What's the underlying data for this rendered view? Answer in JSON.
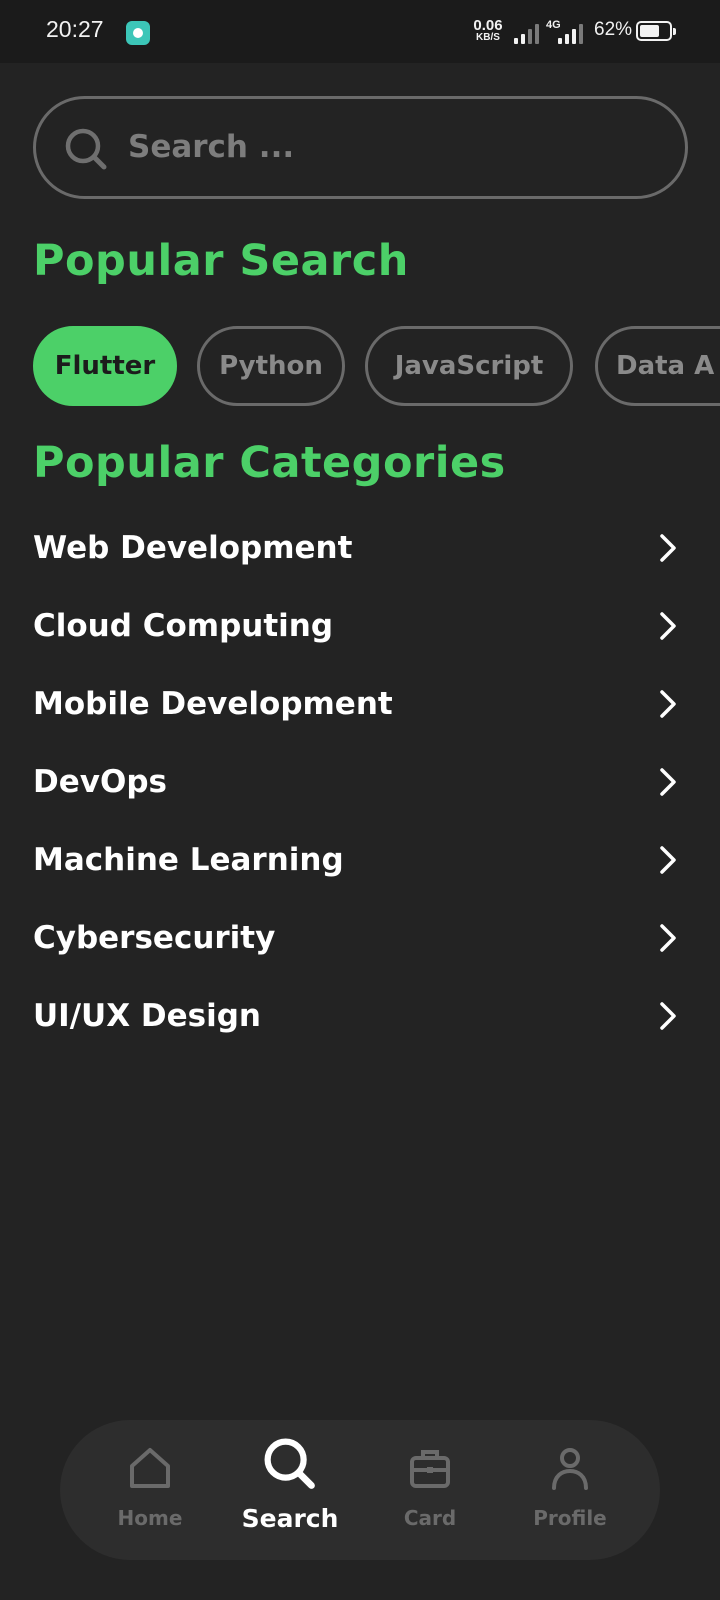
{
  "status_bar": {
    "time": "20:27",
    "net_speed_value": "0.06",
    "net_speed_unit": "KB/S",
    "network_type": "4G",
    "battery_percent": "62%"
  },
  "search": {
    "placeholder": "Search ...",
    "icon": "search-icon"
  },
  "popular_search": {
    "title": "Popular Search",
    "chips": [
      {
        "label": "Flutter",
        "active": true
      },
      {
        "label": "Python",
        "active": false
      },
      {
        "label": "JavaScript",
        "active": false
      },
      {
        "label": "Data A",
        "active": false
      }
    ]
  },
  "popular_categories": {
    "title": "Popular Categories",
    "items": [
      {
        "label": "Web Development"
      },
      {
        "label": "Cloud Computing"
      },
      {
        "label": "Mobile Development"
      },
      {
        "label": "DevOps"
      },
      {
        "label": "Machine Learning"
      },
      {
        "label": "Cybersecurity"
      },
      {
        "label": "UI/UX Design"
      }
    ]
  },
  "bottom_nav": {
    "items": [
      {
        "label": "Home",
        "icon": "home-icon",
        "active": false
      },
      {
        "label": "Search",
        "icon": "search-icon",
        "active": true
      },
      {
        "label": "Card",
        "icon": "briefcase-icon",
        "active": false
      },
      {
        "label": "Profile",
        "icon": "profile-icon",
        "active": false
      }
    ]
  },
  "colors": {
    "background": "#232323",
    "accent": "#4cd068",
    "muted": "#6a6a6a",
    "nav_background": "#2d2d2d"
  }
}
